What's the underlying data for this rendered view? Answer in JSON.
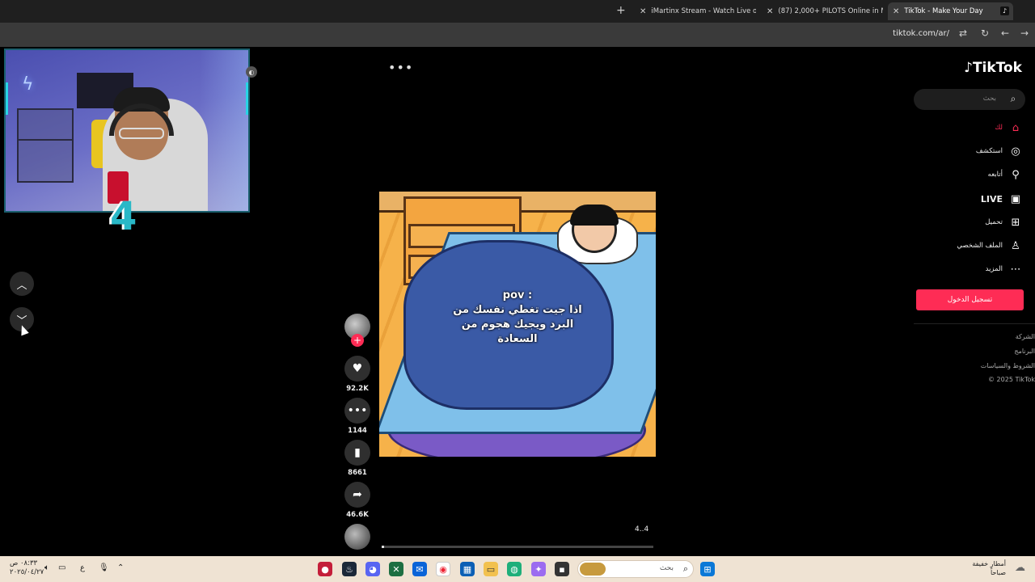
{
  "browser": {
    "tabs": [
      {
        "title": "iMartinx Stream - Watch Live o",
        "favicon_color": "#53fc18"
      },
      {
        "title": "(87) 2,000+ PILOTS Online in M",
        "favicon_color": "#ff0000"
      },
      {
        "title": "TikTok - Make Your Day",
        "favicon_color": "#111111",
        "active": true
      }
    ],
    "new_tab_label": "+",
    "url": "tiktok.com/ar/"
  },
  "sidebar": {
    "brand": "TikTok",
    "search_placeholder": "بحث",
    "nav": [
      {
        "label": "لك",
        "icon": "home-icon",
        "active": true
      },
      {
        "label": "استكشف",
        "icon": "compass-icon"
      },
      {
        "label": "أتابعه",
        "icon": "following-icon"
      },
      {
        "label": "LIVE",
        "icon": "live-icon"
      },
      {
        "label": "تحميل",
        "icon": "upload-icon"
      },
      {
        "label": "الملف الشخصي",
        "icon": "profile-icon"
      },
      {
        "label": "المزيد",
        "icon": "more-icon"
      }
    ],
    "login_label": "تسجيل الدخول",
    "footer": [
      "الشركة",
      "البرنامج",
      "الشروط والسياسات",
      "© 2025 TikTok"
    ]
  },
  "video": {
    "caption_lines": [
      "pov :",
      "اذا جيت تغطي نفسك من",
      "البرد ويجيك هجوم من",
      "السعادة"
    ],
    "progress_label": "4..4",
    "progress_fraction": 0.01
  },
  "actions": {
    "likes": "92.2K",
    "comments": "1144",
    "saves": "8661",
    "shares": "46.6K"
  },
  "overlay": {
    "logo_text": "4"
  },
  "taskbar": {
    "search_placeholder": "بحث",
    "time": "٠٨:٣٣ ص",
    "date": "٢٠٢٥/٠٤/٢٧",
    "lang": "ع",
    "weather_line1": "أمطار خفيفة",
    "weather_line2": "صباحاً"
  },
  "colors": {
    "accent": "#fe2c55",
    "taskbar": "#efe3d3"
  }
}
